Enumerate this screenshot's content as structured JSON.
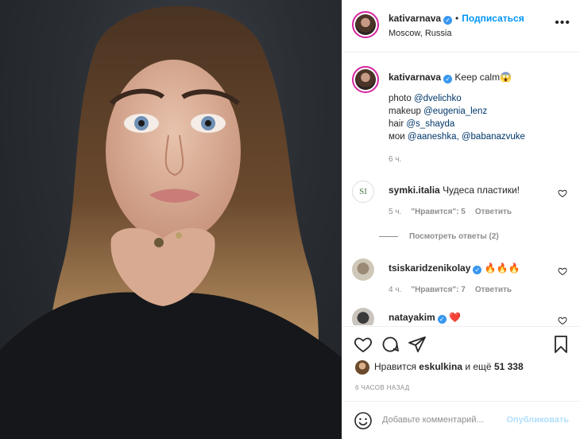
{
  "post": {
    "author": "kativarnava",
    "follow_label": "Подписаться",
    "location": "Moscow, Russia",
    "more": "•••",
    "caption_text": "Keep calm",
    "caption_emoji": "😱",
    "credits": [
      {
        "label": "photo ",
        "handle": "@dvelichko"
      },
      {
        "label": "makeup ",
        "handle": "@eugenia_lenz"
      },
      {
        "label": "hair ",
        "handle": "@s_shayda"
      },
      {
        "label": "мои ",
        "handle": "@aaneshka, @babanazvuke"
      }
    ],
    "caption_time": "6 ч."
  },
  "comments": [
    {
      "user": "symki.italia",
      "text": "Чудеса пластики!",
      "time": "5 ч.",
      "likes": "\"Нравится\": 5",
      "reply": "Ответить",
      "view_replies": "Посмотреть ответы (2)"
    },
    {
      "user": "tsiskaridzenikolay",
      "verified": true,
      "text": "🔥🔥🔥",
      "time": "4 ч.",
      "likes": "\"Нравится\": 7",
      "reply": "Ответить"
    },
    {
      "user": "natayakim",
      "verified": true,
      "text": "❤️"
    }
  ],
  "likes_bar": {
    "prefix": "Нравится ",
    "user": "eskulkina",
    "suffix": " и ещё ",
    "count": "51 338"
  },
  "posted_ago": "6 ЧАСОВ НАЗАД",
  "add_comment": {
    "placeholder": "Добавьте комментарий...",
    "publish": "Опубликовать"
  },
  "icons": [
    "heart-icon",
    "comment-icon",
    "share-icon",
    "bookmark-icon",
    "emoji-icon",
    "verified-icon"
  ],
  "colors": {
    "accent": "#0095f6",
    "verified": "#3897f0",
    "fire": "#f56040",
    "heart": "#ed4956"
  }
}
